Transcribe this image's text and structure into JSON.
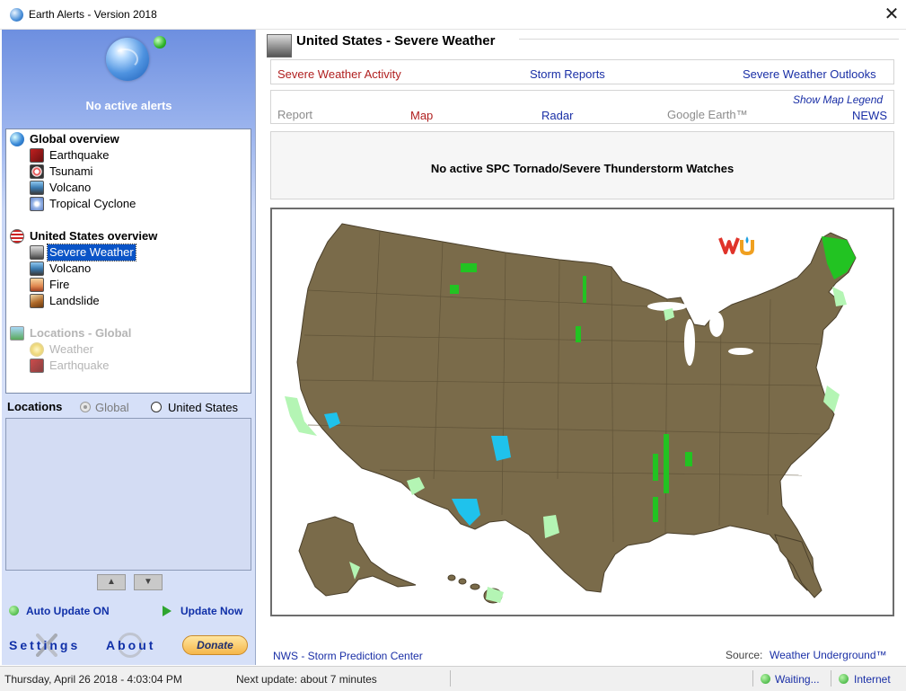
{
  "window": {
    "title": "Earth Alerts - Version 2018",
    "close_glyph": "✕"
  },
  "sidebar": {
    "status": "No active alerts",
    "tree": {
      "global_header": "Global overview",
      "global_items": [
        "Earthquake",
        "Tsunami",
        "Volcano",
        "Tropical Cyclone"
      ],
      "us_header": "United States overview",
      "us_items": [
        "Severe Weather",
        "Volcano",
        "Fire",
        "Landslide"
      ],
      "selected": "Severe Weather",
      "locations_header": "Locations - Global",
      "locations_items": [
        "Weather",
        "Earthquake"
      ]
    },
    "locations_label": "Locations",
    "radio_global": "Global",
    "radio_us": "United States",
    "auto_update": "Auto Update ON",
    "update_now": "Update Now",
    "settings": "Settings",
    "about": "About",
    "donate": "Donate"
  },
  "main": {
    "title": "United States - Severe Weather",
    "nav1": {
      "activity": "Severe Weather Activity",
      "storm_reports": "Storm Reports",
      "outlooks": "Severe Weather Outlooks"
    },
    "nav2": {
      "report": "Report",
      "map": "Map",
      "radar": "Radar",
      "google_earth": "Google Earth™",
      "news": "NEWS",
      "legend": "Show Map Legend"
    },
    "watch_text": "No active SPC Tornado/Severe Thunderstorm Watches",
    "map": {
      "land_color": "#7a6b4a",
      "green": "#22c322",
      "light_green": "#b4f5b4",
      "cyan": "#1fc2ec"
    },
    "footer": {
      "nws": "NWS - Storm Prediction Center",
      "source_label": "Source:",
      "source_link": "Weather Underground™"
    }
  },
  "statusbar": {
    "date": "Thursday, April 26 2018 - 4:03:04 PM",
    "next_update": "Next update: about 7 minutes",
    "waiting": "Waiting...",
    "internet": "Internet"
  }
}
